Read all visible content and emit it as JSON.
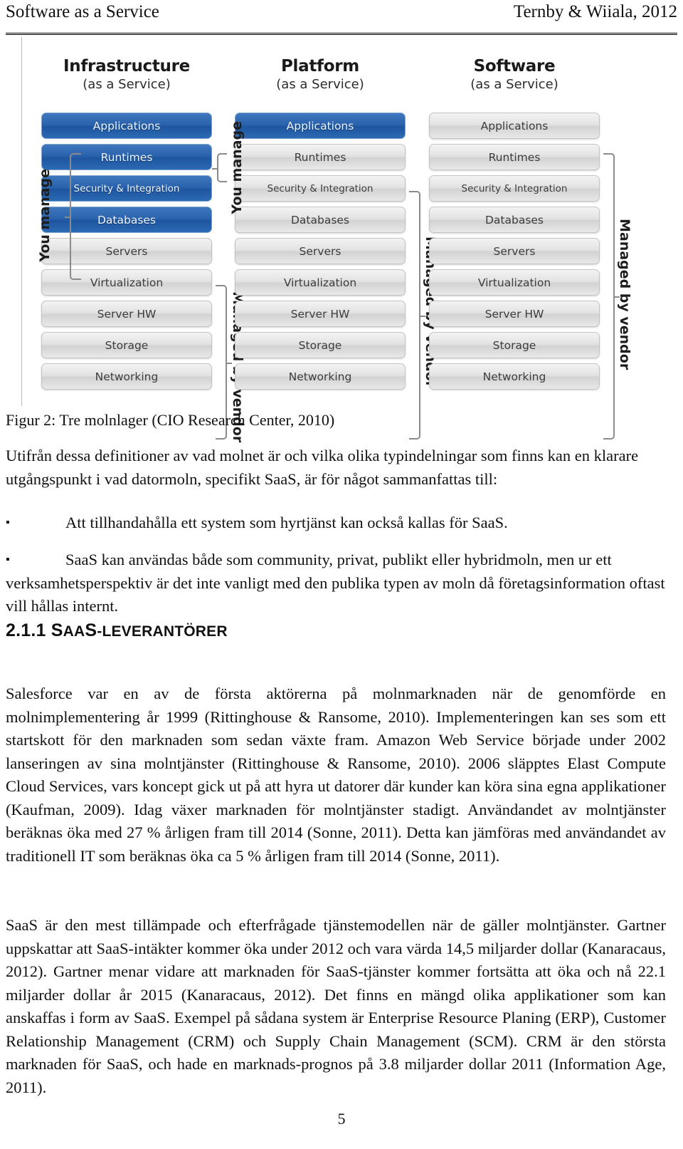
{
  "header": {
    "left": "Software as a Service",
    "right": "Ternby & Wiiala, 2012"
  },
  "figure": {
    "caption": "Figur 2: Tre molnlager (CIO Research Center, 2010)",
    "columns": [
      {
        "id": "iaas",
        "title": "Infrastructure",
        "subtitle": "(as a Service)",
        "layers": [
          {
            "label": "Applications",
            "state": "blue"
          },
          {
            "label": "Runtimes",
            "state": "blue"
          },
          {
            "label": "Security & Integration",
            "state": "blue"
          },
          {
            "label": "Databases",
            "state": "blue"
          },
          {
            "label": "Servers",
            "state": "gray"
          },
          {
            "label": "Virtualization",
            "state": "gray"
          },
          {
            "label": "Server HW",
            "state": "gray"
          },
          {
            "label": "Storage",
            "state": "gray"
          },
          {
            "label": "Networking",
            "state": "gray"
          }
        ],
        "you_manage_label": "You manage",
        "managed_by_vendor_label": "Managed by vendor"
      },
      {
        "id": "paas",
        "title": "Platform",
        "subtitle": "(as a Service)",
        "layers": [
          {
            "label": "Applications",
            "state": "blue"
          },
          {
            "label": "Runtimes",
            "state": "gray"
          },
          {
            "label": "Security & Integration",
            "state": "gray"
          },
          {
            "label": "Databases",
            "state": "gray"
          },
          {
            "label": "Servers",
            "state": "gray"
          },
          {
            "label": "Virtualization",
            "state": "gray"
          },
          {
            "label": "Server HW",
            "state": "gray"
          },
          {
            "label": "Storage",
            "state": "gray"
          },
          {
            "label": "Networking",
            "state": "gray"
          }
        ],
        "you_manage_label": "You manage",
        "managed_by_vendor_label": "Managed by vendor"
      },
      {
        "id": "saas",
        "title": "Software",
        "subtitle": "(as a Service)",
        "layers": [
          {
            "label": "Applications",
            "state": "gray"
          },
          {
            "label": "Runtimes",
            "state": "gray"
          },
          {
            "label": "Security & Integration",
            "state": "gray"
          },
          {
            "label": "Databases",
            "state": "gray"
          },
          {
            "label": "Servers",
            "state": "gray"
          },
          {
            "label": "Virtualization",
            "state": "gray"
          },
          {
            "label": "Server HW",
            "state": "gray"
          },
          {
            "label": "Storage",
            "state": "gray"
          },
          {
            "label": "Networking",
            "state": "gray"
          }
        ],
        "managed_by_vendor_label": "Managed by vendor"
      }
    ]
  },
  "body": {
    "intro": "Utifrån dessa definitioner av vad molnet är och vilka olika typindelningar som finns kan en klarare utgångspunkt i vad datormoln, specifikt SaaS, är för något sammanfattas till:",
    "bullet_marker": "▪",
    "bullets": [
      "Att tillhandahålla ett system som hyrtjänst kan också kallas för SaaS.",
      "SaaS kan användas både som community, privat, publikt eller hybridmoln, men ur ett verksamhetsperspektiv är det inte vanligt med den publika typen av moln då företagsinformation oftast vill hållas internt."
    ],
    "heading": {
      "number": "2.1.1",
      "word_cap1": "S",
      "word_small": "AA",
      "word_cap2": "S",
      "word_rest": "-LEVERANTÖRER"
    },
    "paragraphs": [
      "Salesforce var en av de första aktörerna på molnmarknaden när de genomförde en molnimplementering år 1999 (Rittinghouse & Ransome, 2010). Implementeringen kan ses som ett startskott för den marknaden som sedan växte fram. Amazon Web Service började under 2002 lanseringen av sina molntjänster (Rittinghouse & Ransome, 2010). 2006 släpptes Elast Compute Cloud Services, vars koncept gick ut på att hyra ut datorer där kunder kan köra sina egna applikationer (Kaufman, 2009). Idag växer marknaden för molntjänster stadigt. Användandet av molntjänster beräknas öka med 27 % årligen fram till 2014 (Sonne, 2011). Detta kan jämföras med användandet av traditionell IT som beräknas öka ca 5 % årligen fram till 2014 (Sonne, 2011).",
      "SaaS är den mest tillämpade och efterfrågade tjänstemodellen när de gäller molntjänster. Gartner uppskattar att SaaS-intäkter kommer öka under 2012 och vara värda 14,5 miljarder dollar (Kanaracaus, 2012). Gartner menar vidare att marknaden för SaaS-tjänster kommer fortsätta att öka och nå 22.1 miljarder dollar år 2015 (Kanaracaus, 2012). Det finns en mängd olika applikationer som kan anskaffas i form av SaaS. Exempel på sådana system är Enterprise Resource Planing (ERP), Customer Relationship Management (CRM) och Supply Chain Management (SCM). CRM är den största marknaden för SaaS, och hade en marknads-prognos på 3.8 miljarder dollar 2011 (Information Age, 2011)."
    ]
  },
  "footer": {
    "page_number": "5"
  }
}
